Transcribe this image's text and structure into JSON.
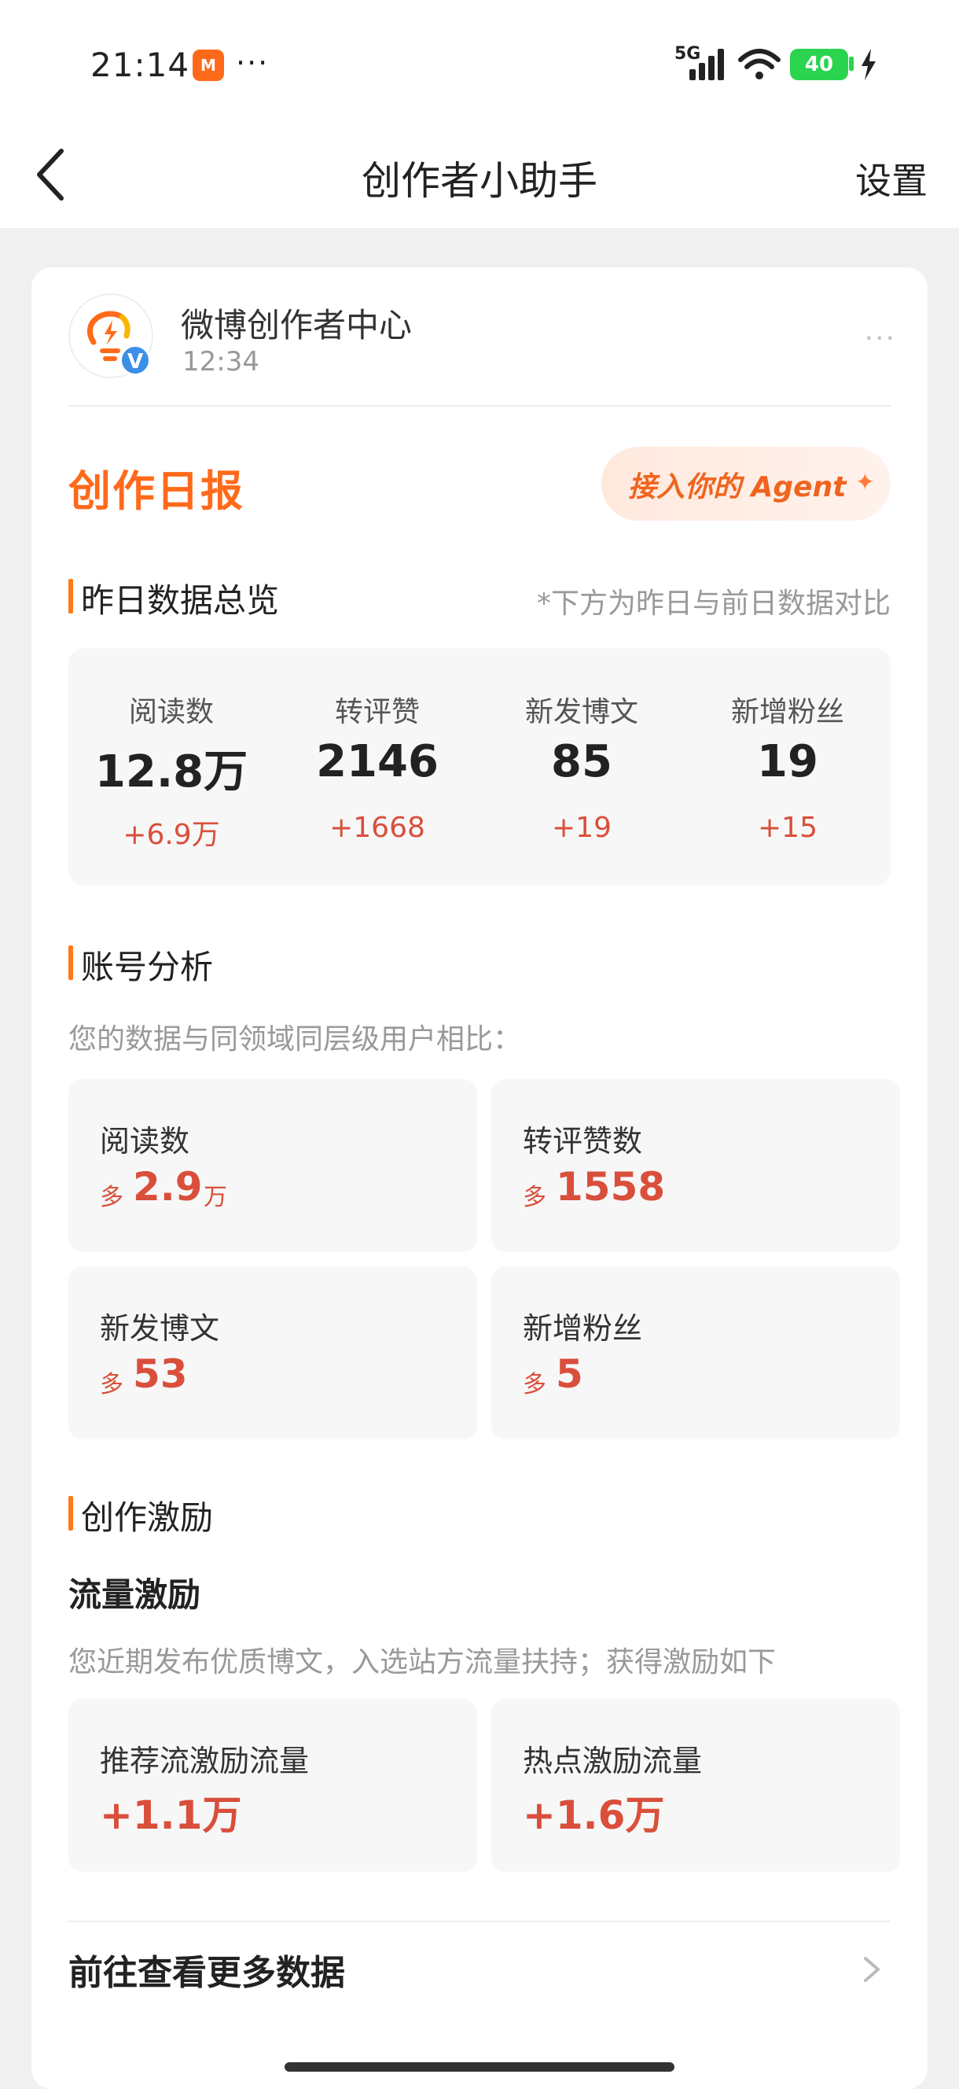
{
  "status_bar": {
    "time": "21:14",
    "app_badge": "M",
    "more": "···",
    "network": "5G",
    "battery": "40"
  },
  "navbar": {
    "title": "创作者小助手",
    "settings": "设置"
  },
  "message": {
    "sender": "微博创作者中心",
    "time": "12:34",
    "verified_mark": "V",
    "more": "···"
  },
  "report": {
    "title": "创作日报",
    "agent_button": "接入你的 Agent",
    "sparkle": "✦"
  },
  "overview": {
    "heading": "昨日数据总览",
    "note": "*下方为昨日与前日数据对比",
    "stats": [
      {
        "label": "阅读数",
        "value": "12.8万",
        "delta": "+6.9万"
      },
      {
        "label": "转评赞",
        "value": "2146",
        "delta": "+1668"
      },
      {
        "label": "新发博文",
        "value": "85",
        "delta": "+19"
      },
      {
        "label": "新增粉丝",
        "value": "19",
        "delta": "+15"
      }
    ]
  },
  "analysis": {
    "heading": "账号分析",
    "note": "您的数据与同领域同层级用户相比：",
    "more_word": "多",
    "tiles": [
      {
        "label": "阅读数",
        "value": "2.9",
        "unit": "万"
      },
      {
        "label": "转评赞数",
        "value": "1558",
        "unit": ""
      },
      {
        "label": "新发博文",
        "value": "53",
        "unit": ""
      },
      {
        "label": "新增粉丝",
        "value": "5",
        "unit": ""
      }
    ]
  },
  "incentive": {
    "heading": "创作激励",
    "subheading": "流量激励",
    "note": "您近期发布优质博文，入选站方流量扶持；获得激励如下",
    "tiles": [
      {
        "label": "推荐流激励流量",
        "value": "+1.1万"
      },
      {
        "label": "热点激励流量",
        "value": "+1.6万"
      }
    ]
  },
  "footer": {
    "more_data": "前往查看更多数据"
  },
  "colors": {
    "accent_orange": "#ff6a1a",
    "delta_red": "#d94f3b",
    "verified_blue": "#3b8fe6"
  }
}
